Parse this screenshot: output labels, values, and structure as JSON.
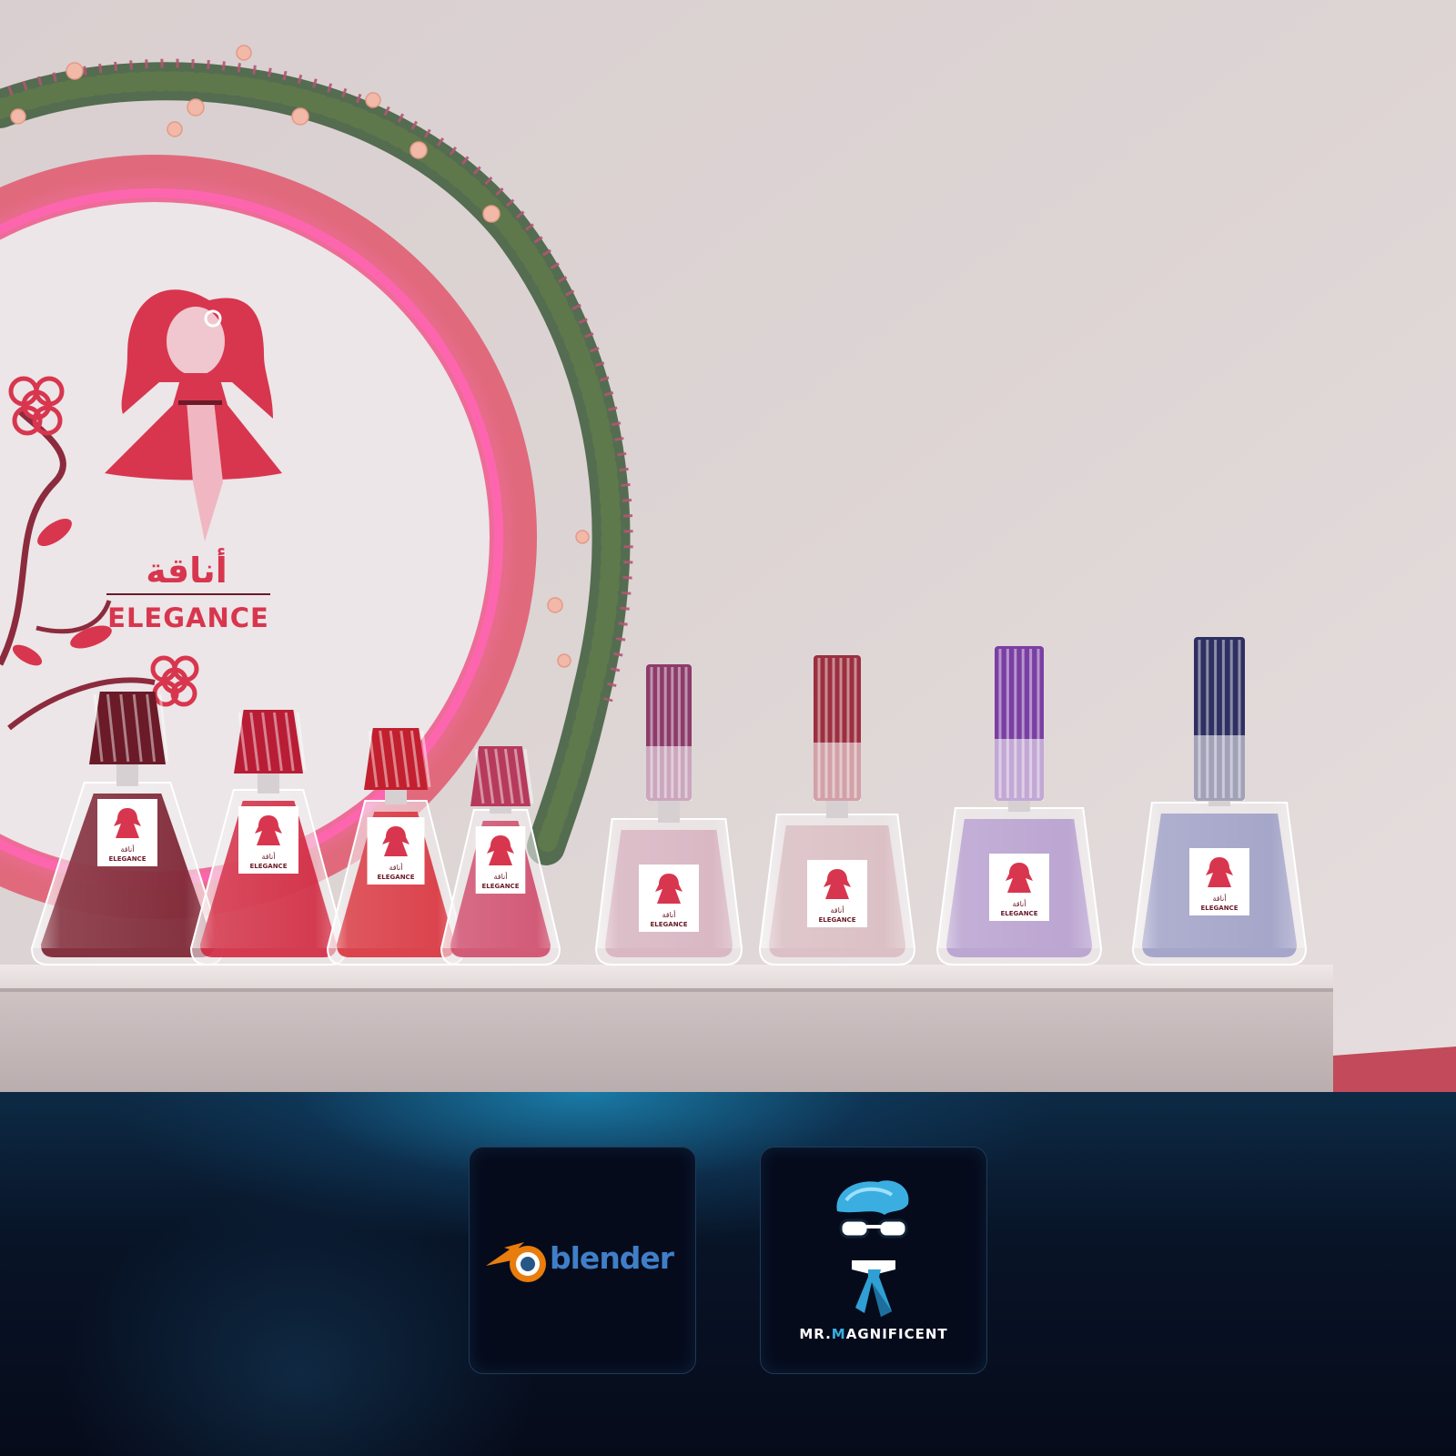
{
  "scene": {
    "sign": {
      "arabic_name": "أناقة",
      "english_name": "ELEGANCE"
    },
    "bottles": [
      {
        "label_arabic": "أناقة",
        "label_english": "ELEGANCE",
        "liquid_color": "#7a1f2e",
        "cap_color": "#6b1a28"
      },
      {
        "label_arabic": "أناقة",
        "label_english": "ELEGANCE",
        "liquid_color": "#d2283f",
        "cap_color": "#b81d35"
      },
      {
        "label_arabic": "أناقة",
        "label_english": "ELEGANCE",
        "liquid_color": "#d9323c",
        "cap_color": "#c2202f"
      },
      {
        "label_arabic": "أناقة",
        "label_english": "ELEGANCE",
        "liquid_color": "#cf4b6b",
        "cap_color": "#b63a5c"
      },
      {
        "label_arabic": "أناقة",
        "label_english": "ELEGANCE",
        "liquid_color": "#d7b2c0",
        "cap_color": "#8d3b6a"
      },
      {
        "label_arabic": "أناقة",
        "label_english": "ELEGANCE",
        "liquid_color": "#d9bcc2",
        "cap_color": "#9c2f3f"
      },
      {
        "label_arabic": "أناقة",
        "label_english": "ELEGANCE",
        "liquid_color": "#b79fcf",
        "cap_color": "#7b3fa3"
      },
      {
        "label_arabic": "أناقة",
        "label_english": "ELEGANCE",
        "liquid_color": "#9f9fc7",
        "cap_color": "#2f2f62"
      }
    ]
  },
  "footer": {
    "badges": [
      {
        "name": "blender",
        "word": "blender",
        "icon": "blender-logo-icon",
        "colors": {
          "orange": "#e87d0d",
          "blue": "#265787",
          "text": "#3f7fc8"
        }
      },
      {
        "name": "mr-magnificent",
        "word_prefix": "MR.",
        "word_accent": "M",
        "word_suffix": "AGNIFICENT",
        "icon": "mr-magnificent-mascot-icon",
        "colors": {
          "hair": "#3aaee0",
          "tie": "#2f9fd4"
        }
      }
    ]
  },
  "colors": {
    "wall": "#dcd2d3",
    "ring": "#e0667a",
    "neon": "#ff5aa8",
    "brand_red": "#d8364e",
    "shelf": "#ebe3e3",
    "footer_bg": "#060b1a"
  }
}
